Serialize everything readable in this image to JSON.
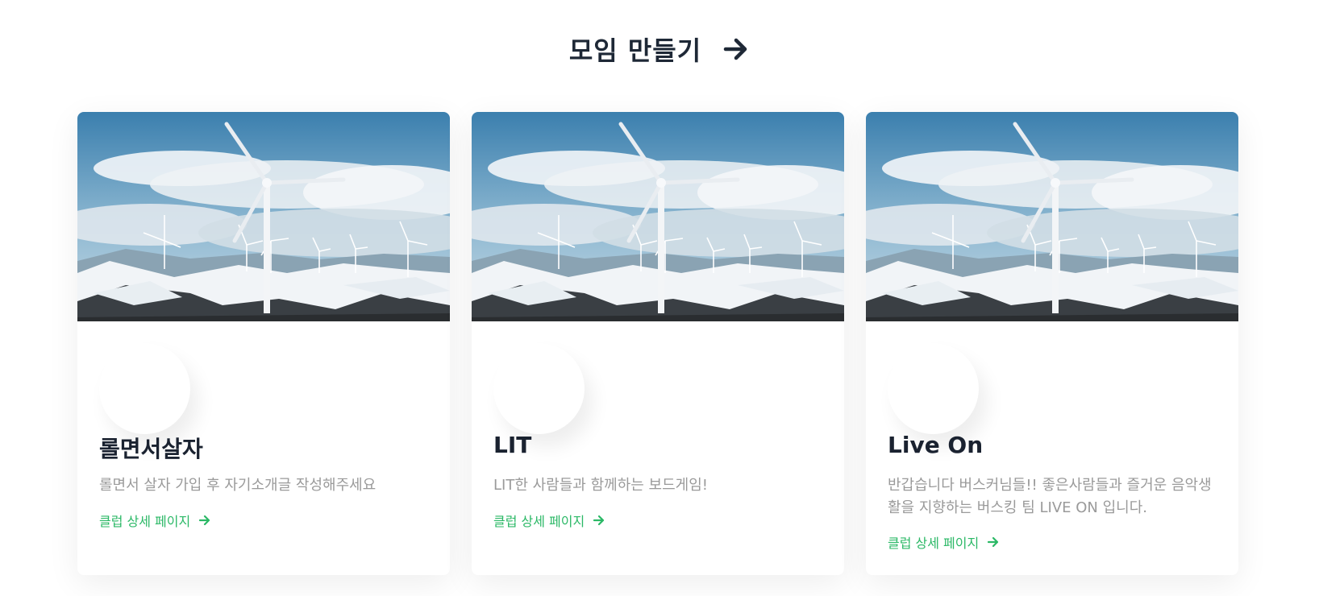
{
  "header": {
    "title": "모임 만들기",
    "arrow_icon": "arrow-right-icon"
  },
  "colors": {
    "title": "#1e2836",
    "link": "#2bb866",
    "desc": "#9a9a9a"
  },
  "clubs": [
    {
      "name": "롤면서살자",
      "description": "롤면서 살자 가입 후 자기소개글 작성해주세요",
      "link_label": "클럽 상세 페이지"
    },
    {
      "name": "LIT",
      "description": "LIT한 사람들과 함께하는 보드게임!",
      "link_label": "클럽 상세 페이지"
    },
    {
      "name": "Live On",
      "description": "반갑습니다 버스커님들!! 좋은사람들과 즐거운 음악생활을 지향하는 버스킹 팀 LIVE ON 입니다.",
      "link_label": "클럽 상세 페이지"
    }
  ]
}
